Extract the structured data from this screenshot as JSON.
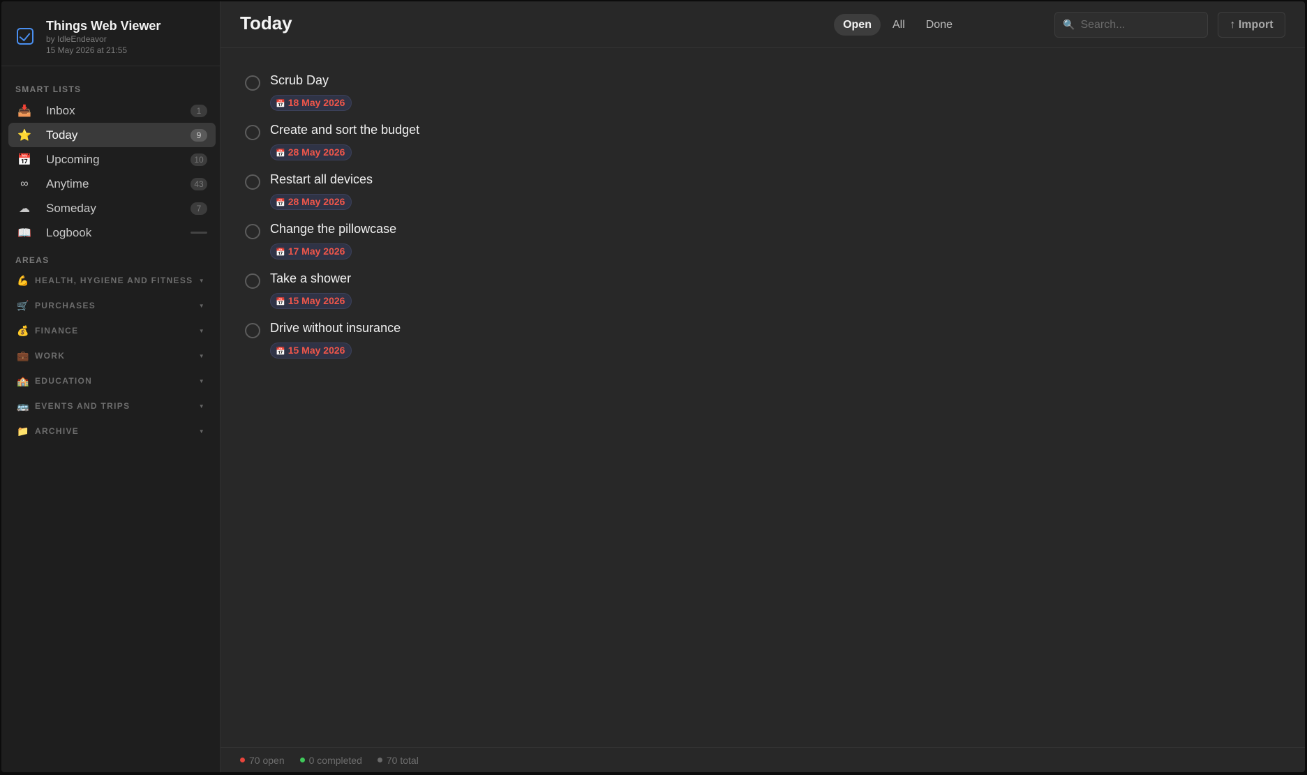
{
  "brand": {
    "title": "Things Web Viewer",
    "author": "by IdleEndeavor",
    "timestamp": "15 May 2026 at 21:55"
  },
  "smart_lists": {
    "label": "SMART LISTS",
    "items": [
      {
        "label": "Inbox",
        "icon": "📥",
        "icon_name": "inbox-tray-icon",
        "count": "1",
        "active": false
      },
      {
        "label": "Today",
        "icon": "⭐",
        "icon_name": "star-icon",
        "count": "9",
        "active": true
      },
      {
        "label": "Upcoming",
        "icon": "📅",
        "icon_name": "calendar-icon",
        "count": "10",
        "active": false
      },
      {
        "label": "Anytime",
        "icon": "∞",
        "icon_name": "infinity-icon",
        "count": "43",
        "active": false
      },
      {
        "label": "Someday",
        "icon": "☁",
        "icon_name": "cloud-icon",
        "count": "7",
        "active": false
      },
      {
        "label": "Logbook",
        "icon": "📖",
        "icon_name": "book-icon",
        "count": "",
        "active": false
      }
    ]
  },
  "areas": {
    "label": "AREAS",
    "items": [
      {
        "label": "HEALTH, HYGIENE AND FITNESS",
        "icon": "💪",
        "icon_name": "flexed-biceps-icon"
      },
      {
        "label": "PURCHASES",
        "icon": "🛒",
        "icon_name": "shopping-cart-icon"
      },
      {
        "label": "FINANCE",
        "icon": "💰",
        "icon_name": "money-bag-icon"
      },
      {
        "label": "WORK",
        "icon": "💼",
        "icon_name": "briefcase-icon"
      },
      {
        "label": "EDUCATION",
        "icon": "🏫",
        "icon_name": "school-icon"
      },
      {
        "label": "EVENTS AND TRIPS",
        "icon": "🚌",
        "icon_name": "bus-icon"
      },
      {
        "label": "ARCHIVE",
        "icon": "📁",
        "icon_name": "folder-icon"
      }
    ]
  },
  "header": {
    "title": "Today",
    "filters": [
      {
        "label": "Open",
        "active": true
      },
      {
        "label": "All",
        "active": false
      },
      {
        "label": "Done",
        "active": false
      }
    ],
    "search_placeholder": "Search...",
    "search_icon": "🔍",
    "import_label": "↑ Import"
  },
  "tasks": [
    {
      "title": "Scrub Day",
      "date": "18 May 2026"
    },
    {
      "title": "Create and sort the budget",
      "date": "28 May 2026"
    },
    {
      "title": "Restart all devices",
      "date": "28 May 2026"
    },
    {
      "title": "Change the pillowcase",
      "date": "17 May 2026"
    },
    {
      "title": "Take a shower",
      "date": "15 May 2026"
    },
    {
      "title": "Drive without insurance",
      "date": "15 May 2026"
    }
  ],
  "status": {
    "open": "70 open",
    "completed": "0 completed",
    "total": "70 total",
    "colors": {
      "open": "#e8453c",
      "completed": "#3fc95a",
      "total": "#6a6a6a"
    }
  },
  "colors": {
    "accent": "#4a8ff0",
    "due_date": "#f0564a"
  }
}
